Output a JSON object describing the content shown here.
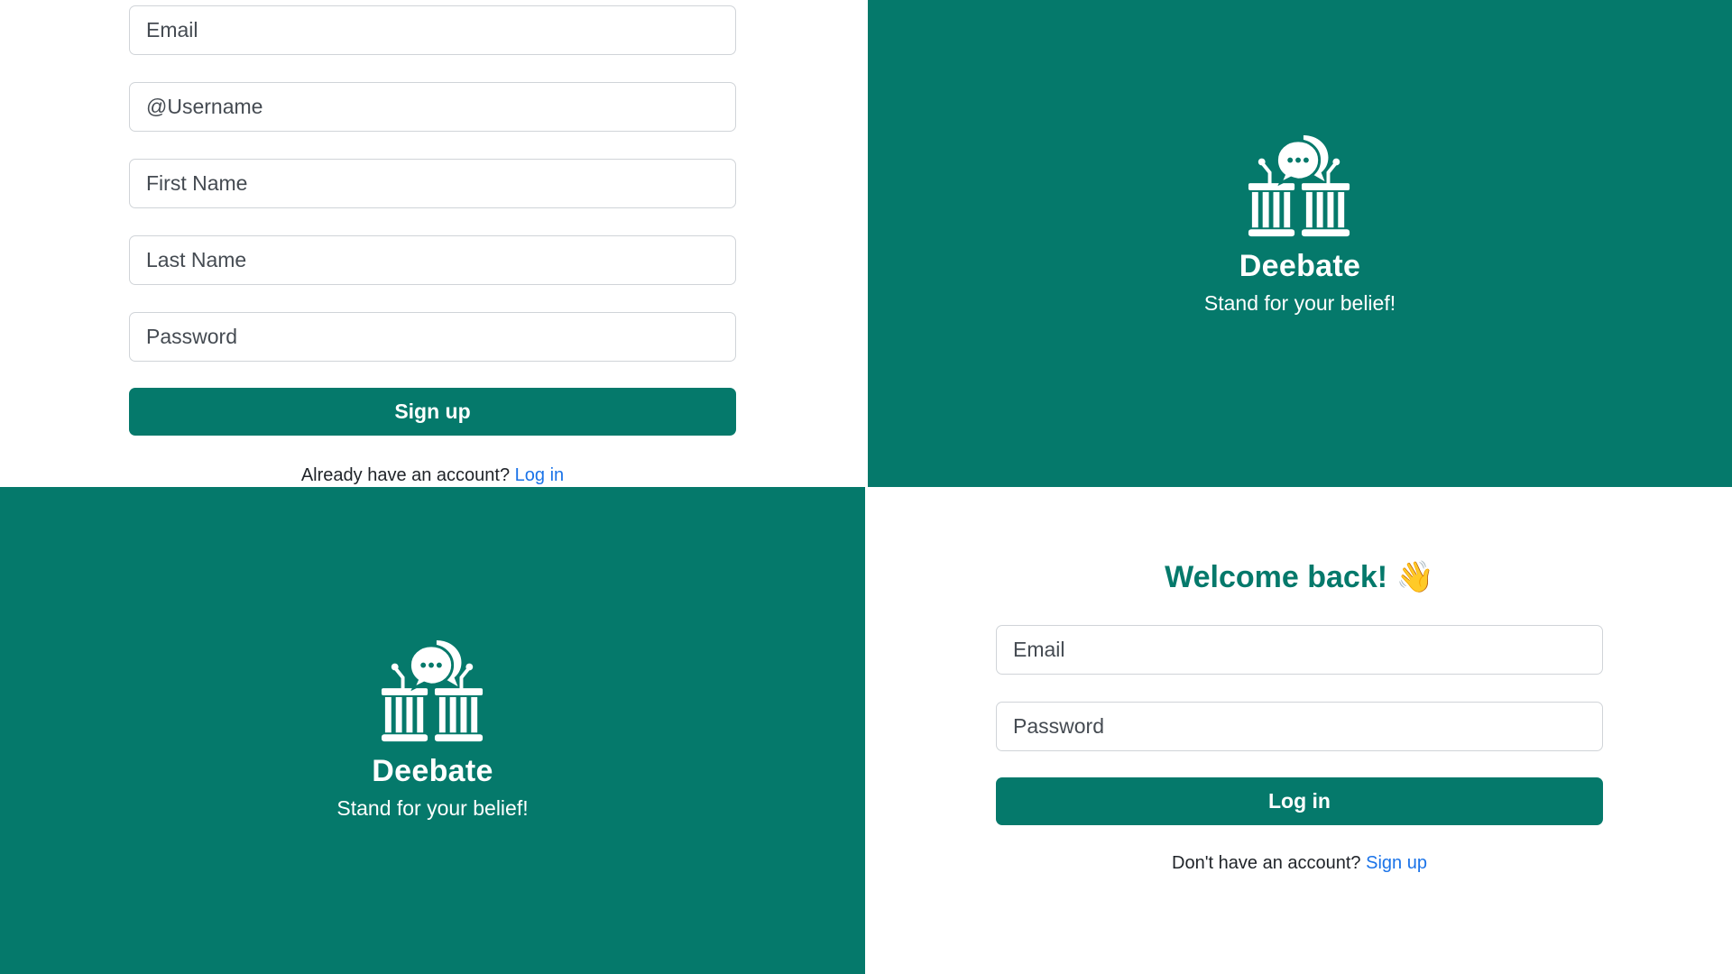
{
  "signup": {
    "fields": [
      {
        "placeholder": "Email"
      },
      {
        "placeholder": "@Username"
      },
      {
        "placeholder": "First Name"
      },
      {
        "placeholder": "Last Name"
      },
      {
        "placeholder": "Password"
      }
    ],
    "submit_label": "Sign up",
    "footer_text": "Already have an account?",
    "footer_link": "Log in"
  },
  "brand": {
    "name": "Deebate",
    "tagline": "Stand for your belief!",
    "logo_icon": "debate-podiums-icon"
  },
  "login": {
    "heading": "Welcome back!",
    "heading_emoji": "👋",
    "fields": [
      {
        "placeholder": "Email"
      },
      {
        "placeholder": "Password"
      }
    ],
    "submit_label": "Log in",
    "footer_text": "Don't have an account?",
    "footer_link": "Sign up"
  },
  "colors": {
    "brand_green": "#05796b",
    "link_blue": "#1a73e8"
  }
}
